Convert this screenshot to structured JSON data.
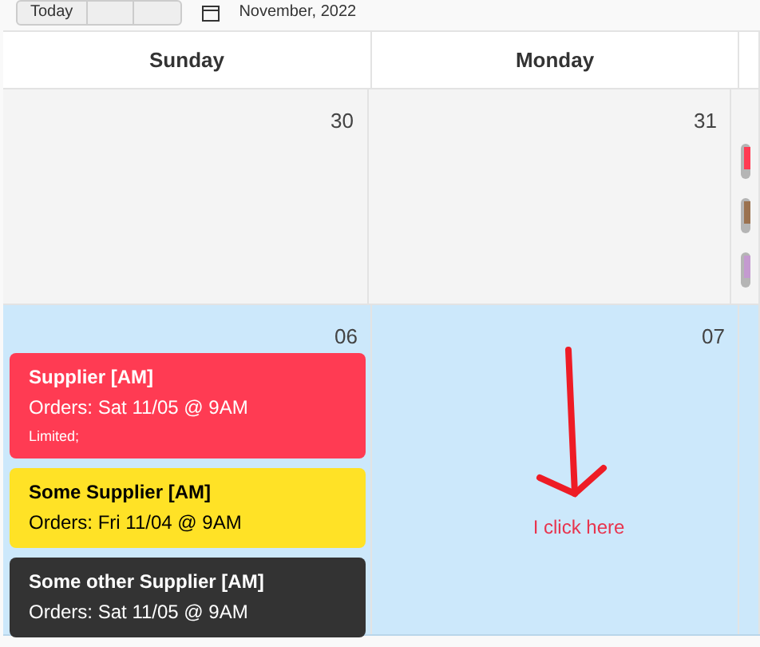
{
  "toolbar": {
    "today_button": "Today",
    "month_label": "November, 2022"
  },
  "columns": [
    {
      "heading": "Sunday"
    },
    {
      "heading": "Monday"
    }
  ],
  "weeks": [
    {
      "selected": false,
      "days": [
        {
          "date": "30"
        },
        {
          "date": "31"
        },
        {
          "events": [
            {
              "color": "#ff3b53"
            },
            {
              "color": "#9b7250"
            },
            {
              "color": "#c49ad0"
            }
          ]
        }
      ]
    },
    {
      "selected": true,
      "days": [
        {
          "date": "06",
          "events": [
            {
              "title": "Supplier [AM]",
              "detail": "Orders: Sat 11/05 @ 9AM",
              "note": "Limited;",
              "color": "#ff3b53"
            },
            {
              "title": "Some Supplier [AM]",
              "detail": "Orders: Fri 11/04 @ 9AM",
              "color": "#ffe226"
            },
            {
              "title": "Some other Supplier [AM]",
              "detail": "Orders: Sat 11/05 @ 9AM",
              "color": "#333333"
            }
          ]
        },
        {
          "date": "07",
          "annotation": "I click here"
        }
      ]
    }
  ]
}
